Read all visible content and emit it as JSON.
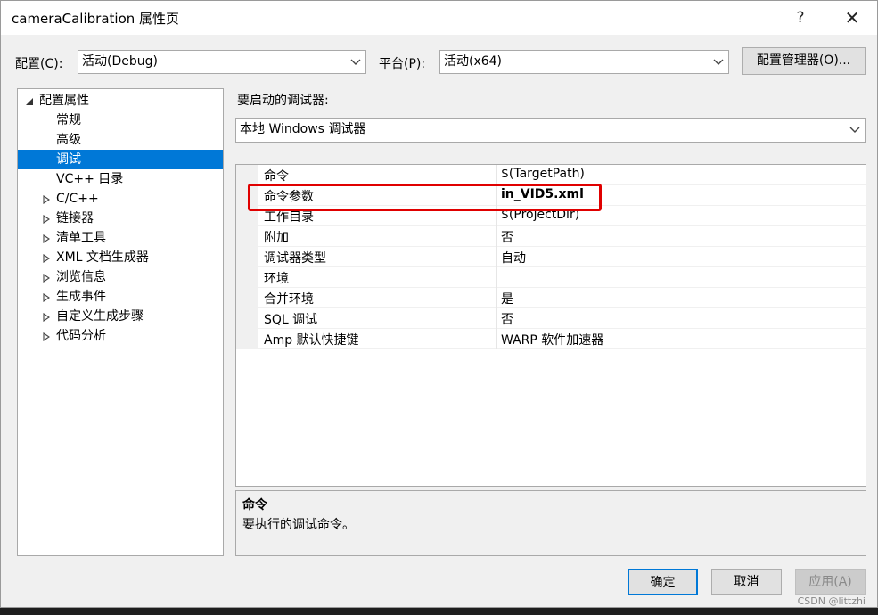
{
  "window": {
    "title": "cameraCalibration 属性页",
    "help_glyph": "?",
    "close_glyph": "✕"
  },
  "config_bar": {
    "config_label": "配置(C):",
    "config_value": "活动(Debug)",
    "platform_label": "平台(P):",
    "platform_value": "活动(x64)",
    "manager_button": "配置管理器(O)..."
  },
  "tree": {
    "root": "配置属性",
    "items": [
      {
        "label": "常规"
      },
      {
        "label": "高级"
      },
      {
        "label": "调试"
      },
      {
        "label": "VC++ 目录"
      },
      {
        "label": "C/C++"
      },
      {
        "label": "链接器"
      },
      {
        "label": "清单工具"
      },
      {
        "label": "XML 文档生成器"
      },
      {
        "label": "浏览信息"
      },
      {
        "label": "生成事件"
      },
      {
        "label": "自定义生成步骤"
      },
      {
        "label": "代码分析"
      }
    ],
    "selected": "调试"
  },
  "debugger": {
    "label": "要启动的调试器:",
    "value": "本地 Windows 调试器"
  },
  "properties": [
    {
      "name": "命令",
      "value": "$(TargetPath)"
    },
    {
      "name": "命令参数",
      "value": "in_VID5.xml"
    },
    {
      "name": "工作目录",
      "value": "$(ProjectDir)"
    },
    {
      "name": "附加",
      "value": "否"
    },
    {
      "name": "调试器类型",
      "value": "自动"
    },
    {
      "name": "环境",
      "value": ""
    },
    {
      "name": "合并环境",
      "value": "是"
    },
    {
      "name": "SQL 调试",
      "value": "否"
    },
    {
      "name": "Amp 默认快捷键",
      "value": "WARP 软件加速器"
    }
  ],
  "description": {
    "title": "命令",
    "body": "要执行的调试命令。"
  },
  "buttons": {
    "ok": "确定",
    "cancel": "取消",
    "apply": "应用(A)"
  },
  "watermark": "CSDN @littzhi",
  "colors": {
    "selection": "#0078d7",
    "highlight_box": "#e00000"
  }
}
